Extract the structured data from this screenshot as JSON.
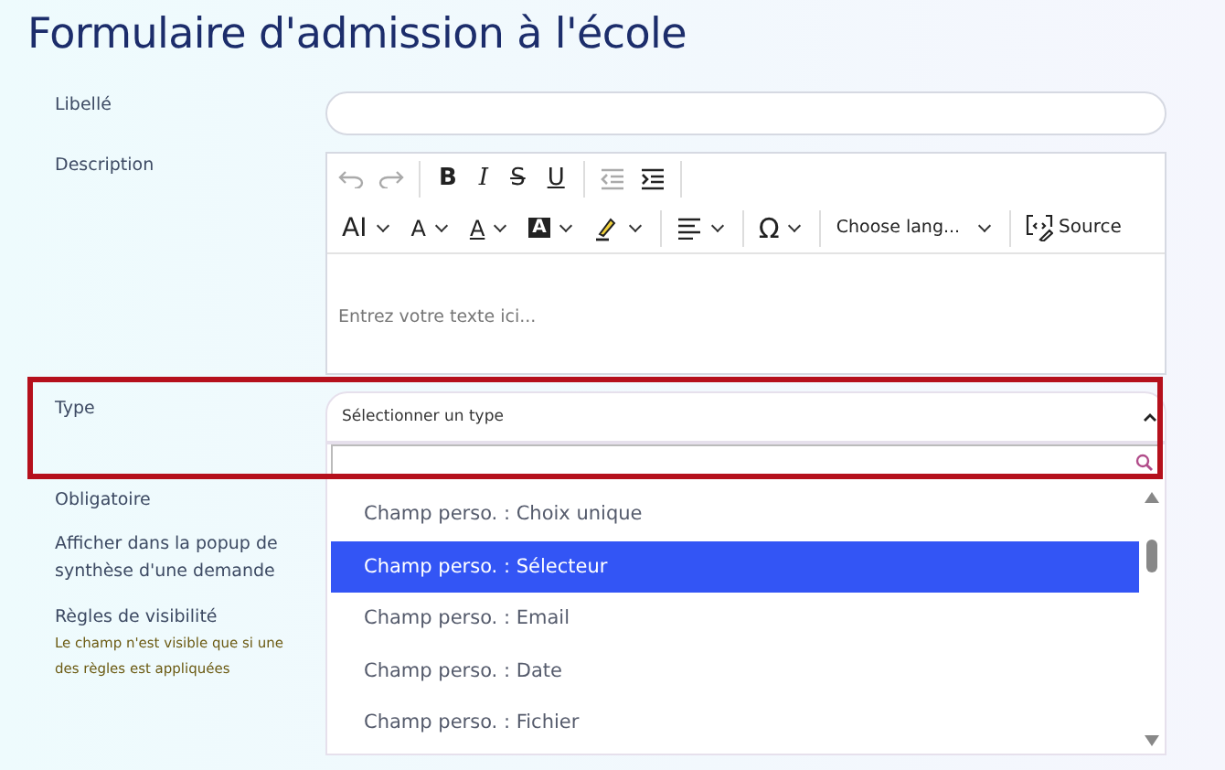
{
  "title": "Formulaire d'admission à l'école",
  "fields": [
    {
      "label": "Libellé",
      "kind": "text"
    },
    {
      "label": "Description",
      "kind": "editor"
    },
    {
      "label": "Type",
      "kind": "select"
    }
  ],
  "editor": {
    "row_1": [
      {
        "kind": "undo",
        "disabled": true
      },
      {
        "kind": "redo",
        "disabled": true
      },
      {
        "kind": "bold",
        "label": "B",
        "disabled": false
      },
      {
        "kind": "italic",
        "label": "I",
        "disabled": false
      },
      {
        "kind": "strike",
        "label": "S",
        "disabled": false
      },
      {
        "kind": "underline",
        "label": "U",
        "disabled": false
      },
      {
        "kind": "outdent",
        "disabled": true
      },
      {
        "kind": "indent",
        "disabled": false
      }
    ],
    "row_2": [
      {
        "kind": "font-family",
        "label": "AI"
      },
      {
        "kind": "font-size",
        "label": "A"
      },
      {
        "kind": "font-color",
        "label": "A"
      },
      {
        "kind": "font-bg",
        "label": "A"
      },
      {
        "kind": "highlight"
      },
      {
        "kind": "sep"
      },
      {
        "kind": "align"
      },
      {
        "kind": "sep"
      },
      {
        "kind": "special",
        "label": "Ω"
      },
      {
        "kind": "sep"
      },
      {
        "kind": "language",
        "label": "Choose lang..."
      },
      {
        "kind": "sep"
      },
      {
        "kind": "source",
        "label": "Source"
      }
    ],
    "placeholder": "Entrez votre texte ici..."
  },
  "type_select": {
    "value": "Sélectionner un type",
    "expanded": true,
    "options": [
      {
        "label": "Champ perso. : Choix unique",
        "selected": false
      },
      {
        "label": "Champ perso. : Sélecteur",
        "selected": true
      },
      {
        "label": "Champ perso. : Email",
        "selected": false
      },
      {
        "label": "Champ perso. : Date",
        "selected": false
      },
      {
        "label": "Champ perso. : Fichier",
        "selected": false
      }
    ]
  },
  "more_labels": [
    {
      "label": "Obligatoire"
    },
    {
      "label": "Afficher dans la popup de synthèse d'une demande"
    },
    {
      "label": "Règles de visibilité",
      "note": "Le champ n'est visible que si une des règles est appliquées"
    }
  ]
}
